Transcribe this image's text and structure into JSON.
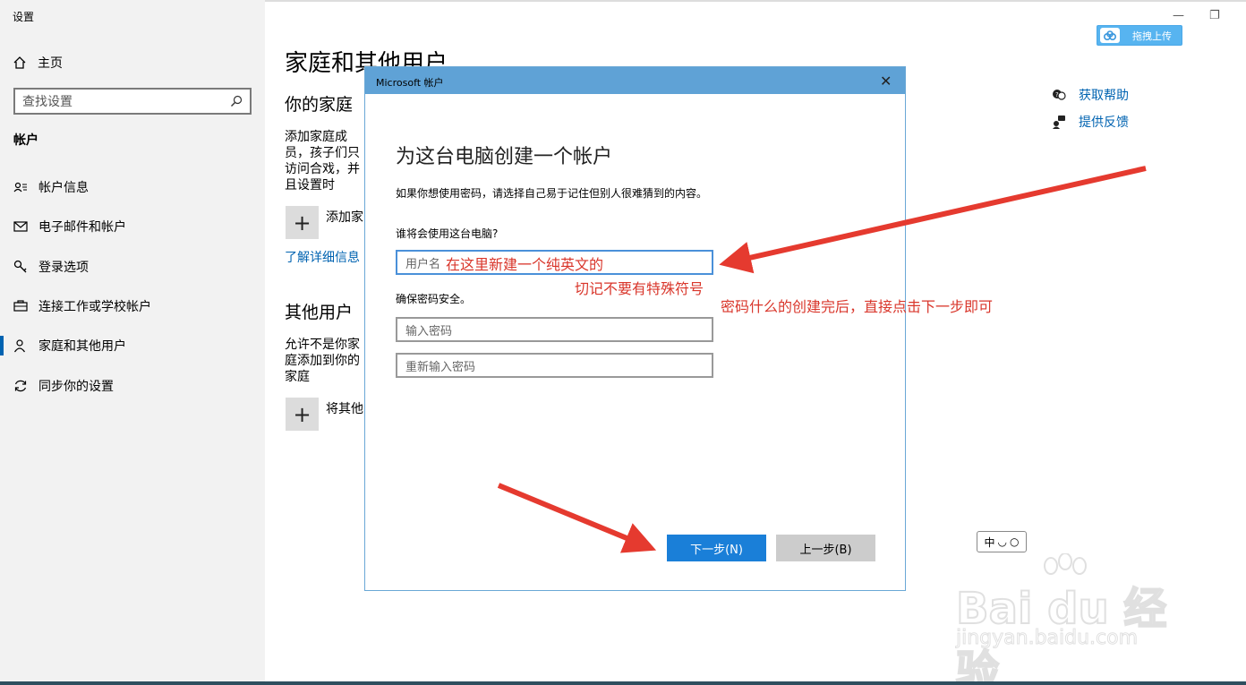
{
  "app": {
    "title": "设置"
  },
  "sidebar": {
    "home": "主页",
    "search_placeholder": "查找设置",
    "section": "帐户",
    "items": [
      {
        "label": "帐户信息",
        "icon": "person-list-icon"
      },
      {
        "label": "电子邮件和帐户",
        "icon": "mail-icon"
      },
      {
        "label": "登录选项",
        "icon": "key-icon"
      },
      {
        "label": "连接工作或学校帐户",
        "icon": "briefcase-icon"
      },
      {
        "label": "家庭和其他用户",
        "icon": "person-icon"
      },
      {
        "label": "同步你的设置",
        "icon": "sync-icon"
      }
    ]
  },
  "main": {
    "title": "家庭和其他用户",
    "family_heading": "你的家庭",
    "family_text": "添加家庭成员，孩子们只访问合戏，并且设置时",
    "add_family_label": "添加家",
    "learn_more": "了解详细信息",
    "others_heading": "其他用户",
    "others_text": "允许不是你家庭添加到你的家庭",
    "add_other_label": "将其他"
  },
  "help": {
    "get_help": "获取帮助",
    "feedback": "提供反馈"
  },
  "upload_button": "拖拽上传",
  "dialog": {
    "titlebar": "Microsoft 帐户",
    "heading": "为这台电脑创建一个帐户",
    "description": "如果你想使用密码，请选择自己易于记住但别人很难猜到的内容。",
    "question": "谁将会使用这台电脑?",
    "username_placeholder": "用户名",
    "password_section": "确保密码安全。",
    "password_placeholder": "输入密码",
    "password_confirm_placeholder": "重新输入密码",
    "next_button": "下一步(N)",
    "back_button": "上一步(B)"
  },
  "annotations": {
    "username_tip": "在这里新建一个纯英文的",
    "special_chars_tip": "切记不要有特殊符号",
    "next_tip": "密码什么的创建完后，直接点击下一步即可",
    "color": "#d9362b"
  },
  "ime": {
    "mode": "中"
  },
  "watermark": {
    "brand": "Bai du 经验",
    "url": "jingyan.baidu.com"
  }
}
